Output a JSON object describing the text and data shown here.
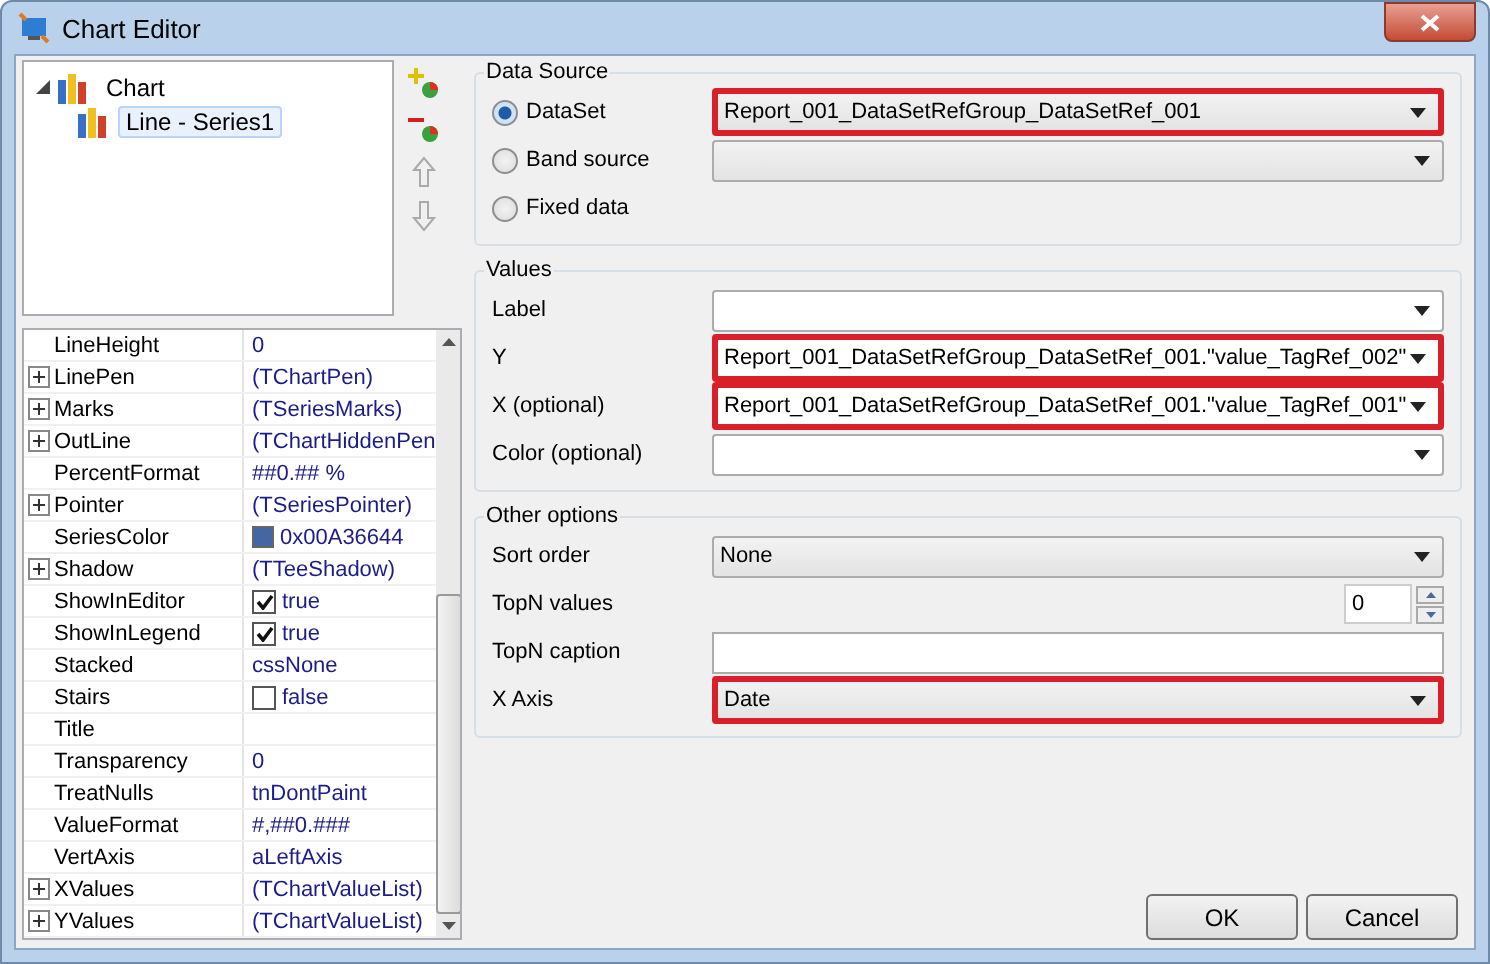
{
  "window": {
    "title": "Chart Editor"
  },
  "tree": [
    {
      "label": "Chart",
      "expanded": true,
      "selected": false,
      "children": [
        {
          "label": "Line - Series1",
          "selected": true
        }
      ]
    }
  ],
  "properties": [
    {
      "name": "LineHeight",
      "value": "0",
      "expandable": false,
      "kind": "text"
    },
    {
      "name": "LinePen",
      "value": "(TChartPen)",
      "expandable": true,
      "kind": "text"
    },
    {
      "name": "Marks",
      "value": "(TSeriesMarks)",
      "expandable": true,
      "kind": "text"
    },
    {
      "name": "OutLine",
      "value": "(TChartHiddenPen",
      "expandable": true,
      "kind": "text"
    },
    {
      "name": "PercentFormat",
      "value": "##0.## %",
      "expandable": false,
      "kind": "text"
    },
    {
      "name": "Pointer",
      "value": "(TSeriesPointer)",
      "expandable": true,
      "kind": "text"
    },
    {
      "name": "SeriesColor",
      "value": "0x00A36644",
      "expandable": false,
      "kind": "color",
      "color": "#4466a3"
    },
    {
      "name": "Shadow",
      "value": "(TTeeShadow)",
      "expandable": true,
      "kind": "text"
    },
    {
      "name": "ShowInEditor",
      "value": "true",
      "expandable": false,
      "kind": "check",
      "checked": true
    },
    {
      "name": "ShowInLegend",
      "value": "true",
      "expandable": false,
      "kind": "check",
      "checked": true
    },
    {
      "name": "Stacked",
      "value": "cssNone",
      "expandable": false,
      "kind": "text"
    },
    {
      "name": "Stairs",
      "value": "false",
      "expandable": false,
      "kind": "check",
      "checked": false
    },
    {
      "name": "Title",
      "expandable": false,
      "kind": "text"
    },
    {
      "name": "Transparency",
      "value": "0",
      "expandable": false,
      "kind": "text"
    },
    {
      "name": "TreatNulls",
      "value": "tnDontPaint",
      "expandable": false,
      "kind": "text"
    },
    {
      "name": "ValueFormat",
      "value": "#,##0.###",
      "expandable": false,
      "kind": "text"
    },
    {
      "name": "VertAxis",
      "value": "aLeftAxis",
      "expandable": false,
      "kind": "text"
    },
    {
      "name": "XValues",
      "value": "(TChartValueList)",
      "expandable": true,
      "kind": "text"
    },
    {
      "name": "YValues",
      "value": "(TChartValueList)",
      "expandable": true,
      "kind": "text"
    }
  ],
  "data_source": {
    "title": "Data Source",
    "options": [
      {
        "label": "DataSet",
        "selected": true,
        "field": {
          "value": "Report_001_DataSetRefGroup_DataSetRef_001",
          "highlighted": true
        }
      },
      {
        "label": "Band source",
        "selected": false,
        "field": {
          "highlighted": false
        }
      },
      {
        "label": "Fixed data",
        "selected": false
      }
    ]
  },
  "values": {
    "title": "Values",
    "rows": [
      {
        "label": "Label",
        "highlighted": false
      },
      {
        "label": "Y",
        "value": "Report_001_DataSetRefGroup_DataSetRef_001.\"value_TagRef_002\"",
        "highlighted": true
      },
      {
        "label": "X (optional)",
        "value": "Report_001_DataSetRefGroup_DataSetRef_001.\"value_TagRef_001\"",
        "highlighted": true
      },
      {
        "label": "Color (optional)",
        "highlighted": false
      }
    ]
  },
  "other_options": {
    "title": "Other options",
    "rows": [
      {
        "label": "Sort order",
        "kind": "combo",
        "value": "None",
        "highlighted": false
      },
      {
        "label": "TopN values",
        "kind": "spin",
        "value": "0",
        "highlighted": false
      },
      {
        "label": "TopN caption",
        "kind": "text",
        "highlighted": false
      },
      {
        "label": "X Axis",
        "kind": "combo",
        "value": "Date",
        "highlighted": true
      }
    ]
  },
  "buttons": [
    "OK",
    "Cancel"
  ]
}
